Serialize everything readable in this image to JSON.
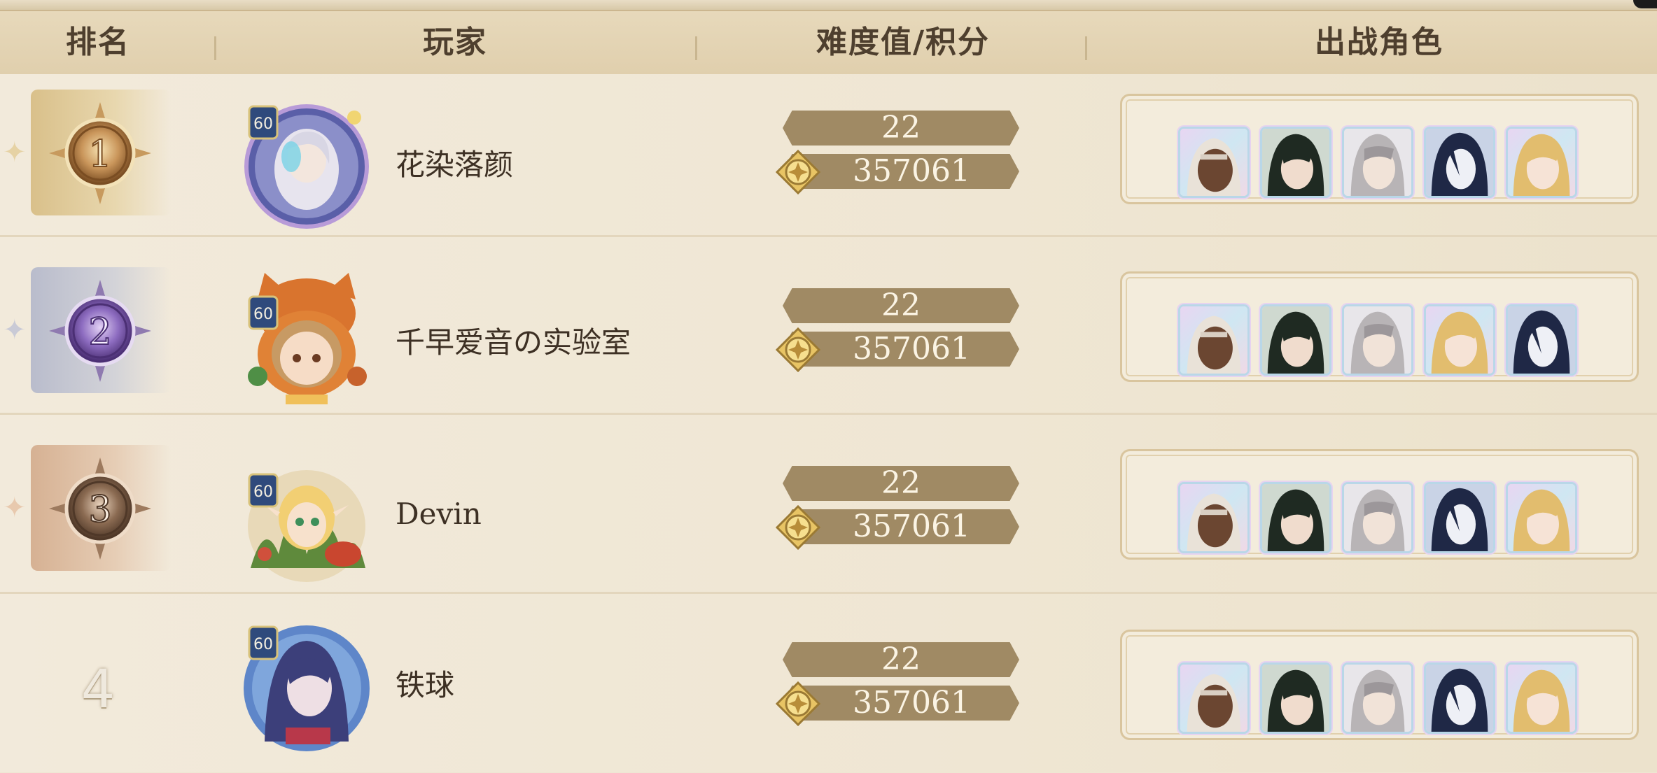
{
  "header": {
    "rank": "排名",
    "player": "玩家",
    "difficulty_score": "难度值/积分",
    "characters": "出战角色"
  },
  "rows": [
    {
      "rank": "1",
      "name": "花染落颜",
      "level": "60",
      "difficulty": "22",
      "score": "357061",
      "medal": "gold"
    },
    {
      "rank": "2",
      "name": "千早爱音の实验室",
      "level": "60",
      "difficulty": "22",
      "score": "357061",
      "medal": "silver"
    },
    {
      "rank": "3",
      "name": "Devin",
      "level": "60",
      "difficulty": "22",
      "score": "357061",
      "medal": "bronze"
    },
    {
      "rank": "4",
      "name": "铁球",
      "level": "60",
      "difficulty": "22",
      "score": "357061",
      "medal": "none"
    }
  ],
  "character_icons": [
    [
      "character-dark-skin-white-hood",
      "character-dark-hair-green",
      "character-silver-hair",
      "character-navy-hair",
      "character-blonde"
    ],
    [
      "character-dark-skin-white-hood",
      "character-dark-hair-green",
      "character-silver-hair",
      "character-blonde",
      "character-navy-hair"
    ],
    [
      "character-dark-skin-white-hood",
      "character-dark-hair-green",
      "character-silver-hair",
      "character-navy-hair",
      "character-blonde"
    ],
    [
      "character-dark-skin-white-hood",
      "character-dark-hair-green",
      "character-silver-hair",
      "character-navy-hair",
      "character-blonde"
    ]
  ],
  "colors": {
    "background": "#efe6d3",
    "header": "#e0cfad",
    "ribbon": "#a08a64",
    "gold_medal": "#8a5a2b",
    "silver_medal": "#6a4a8e",
    "bronze_medal": "#6e5341"
  }
}
